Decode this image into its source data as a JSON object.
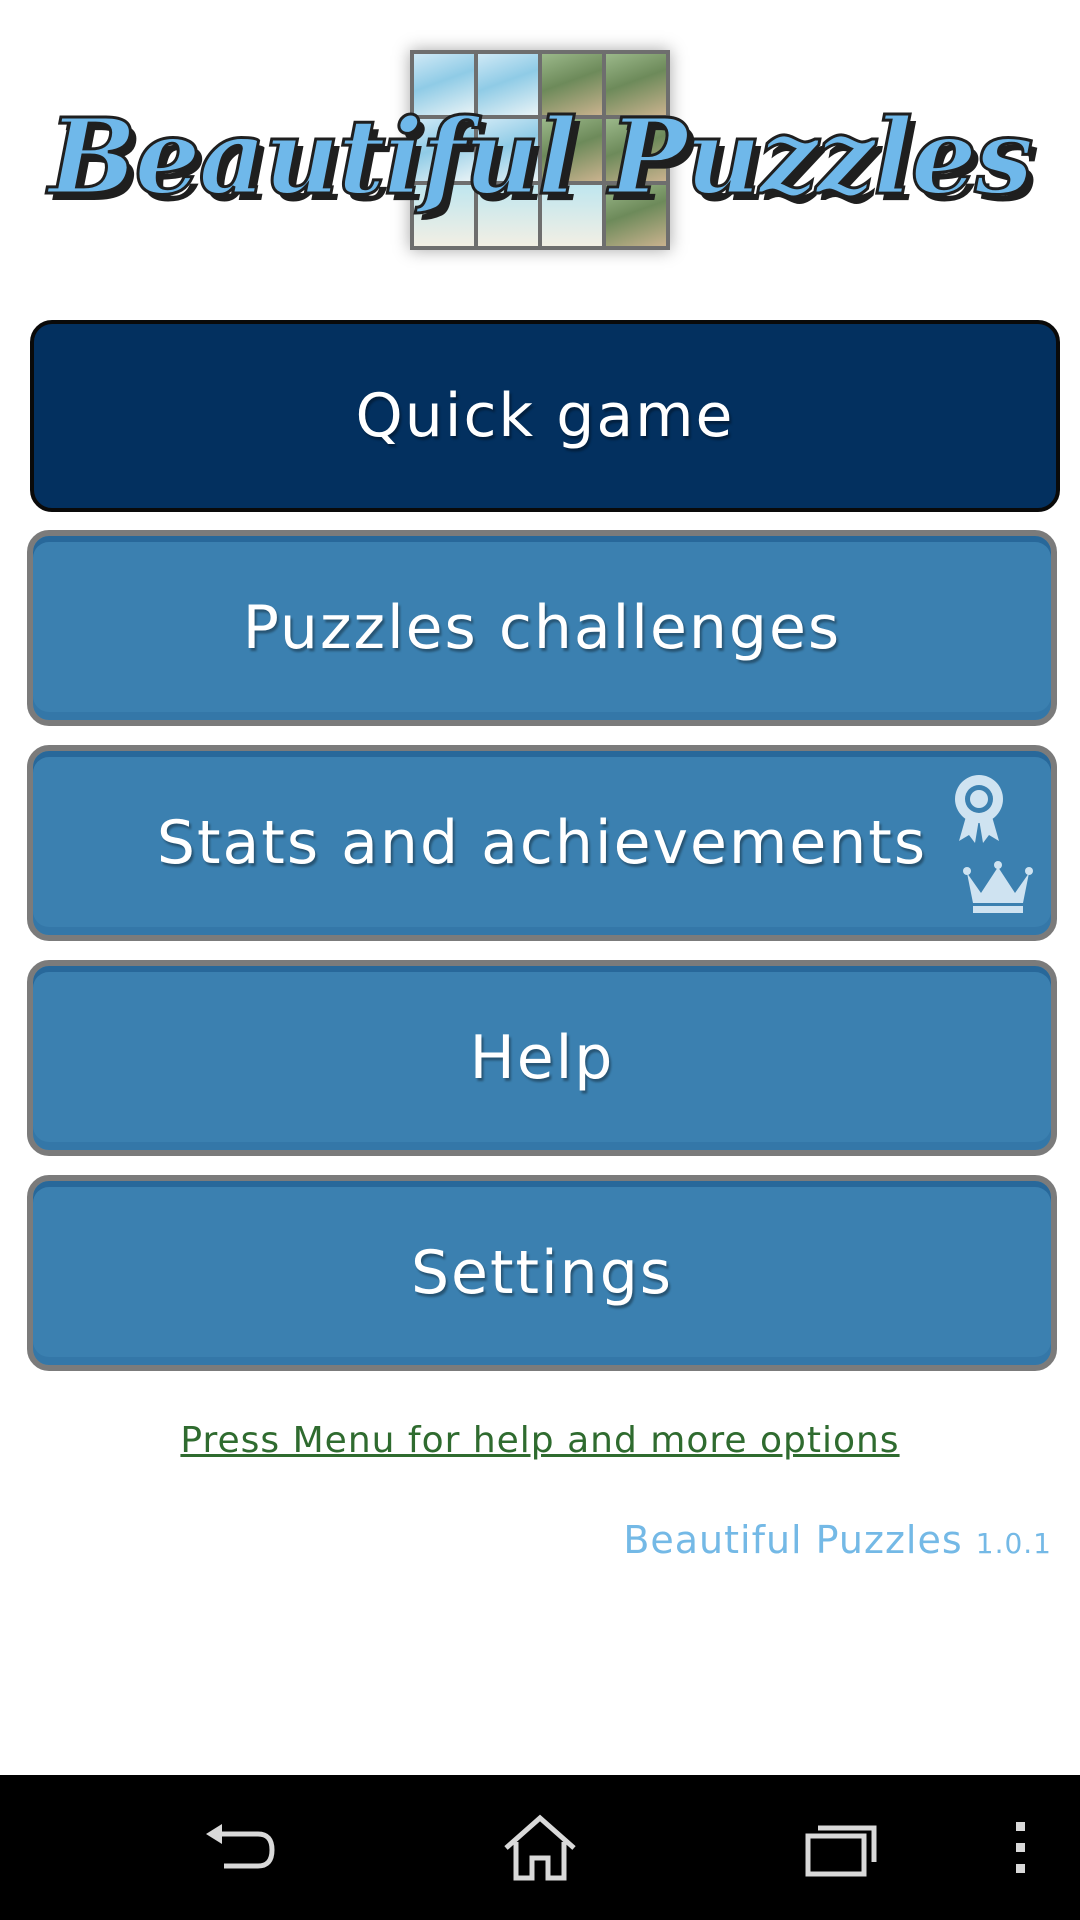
{
  "app": {
    "logo_text": "Beautiful Puzzles"
  },
  "menu": {
    "quick_game": "Quick game",
    "puzzles_challenges": "Puzzles challenges",
    "stats_achievements": "Stats and achievements",
    "help": "Help",
    "settings": "Settings"
  },
  "footer": {
    "menu_hint": "Press Menu for help and more options",
    "version_name": "Beautiful Puzzles",
    "version_number": "1.0.1"
  },
  "icons": {
    "achievements": [
      "ribbon-award-icon",
      "crown-icon"
    ],
    "navbar": [
      "back-icon",
      "home-icon",
      "recent-apps-icon",
      "overflow-menu-icon"
    ]
  },
  "colors": {
    "primary_button": "#03305f",
    "secondary_button": "#3b80b0",
    "logo_text": "#6fb8ea",
    "hint_link": "#2f6b2f",
    "version_text": "#74b9e6"
  }
}
